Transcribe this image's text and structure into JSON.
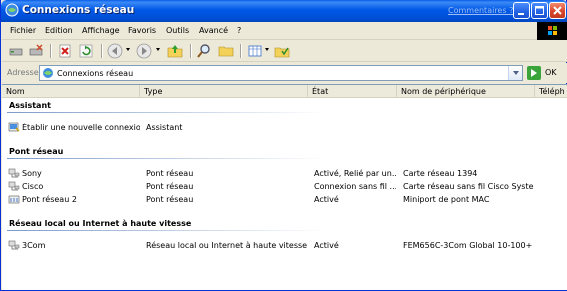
{
  "window": {
    "title": "Connexions réseau",
    "comments_link": "Commentaires ?"
  },
  "menu": [
    "Fichier",
    "Edition",
    "Affichage",
    "Favoris",
    "Outils",
    "Avancé",
    "?"
  ],
  "address": {
    "label": "Adresse",
    "value": "Connexions réseau",
    "go_label": "OK"
  },
  "columns": [
    "Nom",
    "Type",
    "État",
    "Nom de périphérique",
    "Téléph"
  ],
  "groups": [
    {
      "title": "Assistant",
      "rows": [
        {
          "icon": "new-connection-wizard-icon",
          "name": "Établir une nouvelle connexion",
          "type": "Assistant",
          "state": "",
          "device": ""
        }
      ]
    },
    {
      "title": "Pont réseau",
      "rows": [
        {
          "icon": "network-connection-icon",
          "name": "Sony",
          "type": "Pont réseau",
          "state": "Activé, Relié par un...",
          "device": "Carte réseau 1394"
        },
        {
          "icon": "network-connection-icon",
          "name": "Cisco",
          "type": "Pont réseau",
          "state": "Connexion sans fil ...",
          "device": "Carte réseau sans fil Cisco Syste..."
        },
        {
          "icon": "network-bridge-icon",
          "name": "Pont réseau 2",
          "type": "Pont réseau",
          "state": "Activé",
          "device": "Miniport de pont MAC"
        }
      ]
    },
    {
      "title": "Réseau local ou Internet à haute vitesse",
      "rows": [
        {
          "icon": "network-connection-icon",
          "name": "3Com",
          "type": "Réseau local ou Internet à haute vitesse",
          "state": "Activé",
          "device": "FEM656C-3Com Global 10-100+ ..."
        }
      ]
    }
  ]
}
